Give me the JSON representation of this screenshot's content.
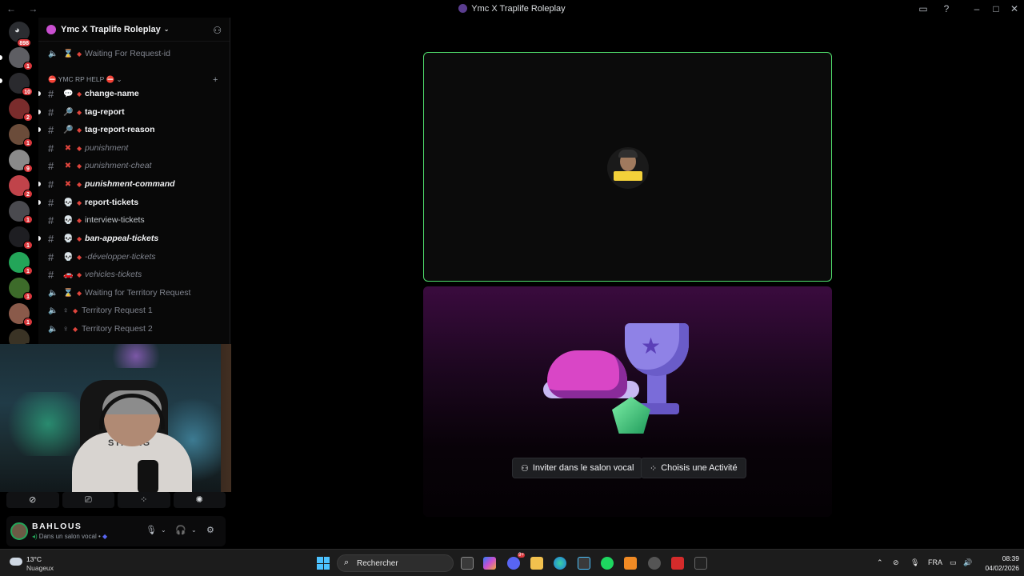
{
  "window": {
    "title": "Ymc X Traplife Roleplay",
    "nav": "← →"
  },
  "rail": {
    "home_badge": "898",
    "servers": [
      {
        "badge": "1"
      },
      {
        "badge": "10"
      },
      {
        "badge": "2"
      },
      {
        "badge": "1"
      },
      {
        "badge": "9"
      },
      {
        "badge": "2"
      },
      {
        "badge": "1"
      },
      {
        "badge": "1"
      },
      {
        "badge": "1"
      },
      {
        "badge": "1"
      },
      {
        "badge": "1"
      },
      {
        "badge": "2"
      }
    ]
  },
  "sidebar": {
    "server_name": "Ymc X Traplife Roleplay",
    "top_channel": {
      "name": "Waiting For Request-id",
      "emoji": "⌛"
    },
    "category": "⛔ YMC RP HELP ⛔",
    "channels": [
      {
        "name": "change-name",
        "emoji": "💬",
        "style": "bold"
      },
      {
        "name": "tag-report",
        "emoji": "🔎",
        "style": "bold"
      },
      {
        "name": "tag-report-reason",
        "emoji": "🔎",
        "style": "bold"
      },
      {
        "name": "punishment",
        "emoji": "✖",
        "style": "ital"
      },
      {
        "name": "punishment-cheat",
        "emoji": "✖",
        "style": "ital"
      },
      {
        "name": "punishment-command",
        "emoji": "✖",
        "style": "bold ital"
      },
      {
        "name": "report-tickets",
        "emoji": "💀",
        "style": "bold"
      },
      {
        "name": "interview-tickets",
        "emoji": "💀",
        "style": "muted"
      },
      {
        "name": "ban-appeal-tickets",
        "emoji": "💀",
        "style": "bold ital"
      },
      {
        "name": "-développer-tickets",
        "emoji": "💀",
        "style": "ital"
      },
      {
        "name": "vehicles-tickets",
        "emoji": "🚗",
        "style": "ital"
      }
    ],
    "voice_channels": [
      {
        "name": "Waiting for Territory Request",
        "emoji": "⌛"
      },
      {
        "name": "Territory Request 1",
        "emoji": "♀"
      },
      {
        "name": "Territory Request 2",
        "emoji": "♀"
      }
    ]
  },
  "webcam": {
    "shirt_text": "STRONG"
  },
  "user": {
    "name": "BAHLOUS",
    "status": "Dans un salon vocal •"
  },
  "activity": {
    "invite_label": "Inviter dans le salon vocal",
    "choose_label": "Choisis une Activité"
  },
  "taskbar": {
    "temperature": "13°C",
    "condition": "Nuageux",
    "search_placeholder": "Rechercher",
    "language": "FRA",
    "time": "08:39",
    "date": "04/02/2026",
    "discord_badge": "9+"
  },
  "colors": {
    "accent_green": "#4fdc6b",
    "badge_red": "#da373c",
    "unread_diamond": "#e0453d"
  }
}
